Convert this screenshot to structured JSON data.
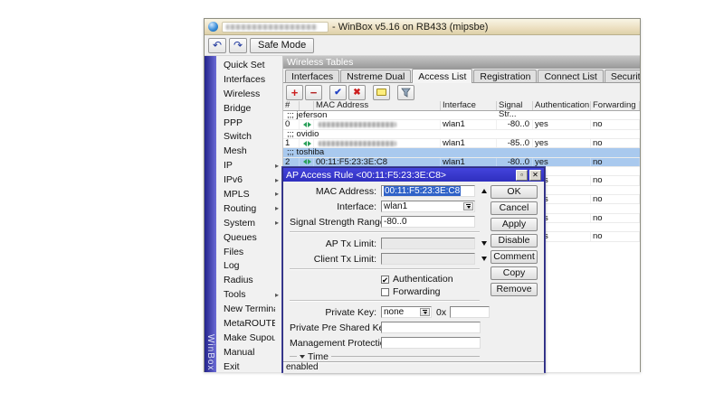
{
  "window": {
    "title_suffix": "- WinBox v5.16 on RB433 (mipsbe)",
    "brand": "WinBox",
    "toolbar": {
      "undo": "↶",
      "redo": "↷",
      "safe_mode": "Safe Mode"
    }
  },
  "sidebar": {
    "items": [
      {
        "label": "Quick Set",
        "submenu": false
      },
      {
        "label": "Interfaces",
        "submenu": false
      },
      {
        "label": "Wireless",
        "submenu": false
      },
      {
        "label": "Bridge",
        "submenu": false
      },
      {
        "label": "PPP",
        "submenu": false
      },
      {
        "label": "Switch",
        "submenu": false
      },
      {
        "label": "Mesh",
        "submenu": false
      },
      {
        "label": "IP",
        "submenu": true
      },
      {
        "label": "IPv6",
        "submenu": true
      },
      {
        "label": "MPLS",
        "submenu": true
      },
      {
        "label": "Routing",
        "submenu": true
      },
      {
        "label": "System",
        "submenu": true
      },
      {
        "label": "Queues",
        "submenu": false
      },
      {
        "label": "Files",
        "submenu": false
      },
      {
        "label": "Log",
        "submenu": false
      },
      {
        "label": "Radius",
        "submenu": false
      },
      {
        "label": "Tools",
        "submenu": true
      },
      {
        "label": "New Terminal",
        "submenu": false
      },
      {
        "label": "MetaROUTER",
        "submenu": false
      },
      {
        "label": "Make Supout.rif",
        "submenu": false
      },
      {
        "label": "Manual",
        "submenu": false
      },
      {
        "label": "Exit",
        "submenu": false
      }
    ]
  },
  "panel": {
    "title": "Wireless Tables",
    "tabs": [
      {
        "label": "Interfaces",
        "active": false
      },
      {
        "label": "Nstreme Dual",
        "active": false
      },
      {
        "label": "Access List",
        "active": true
      },
      {
        "label": "Registration",
        "active": false
      },
      {
        "label": "Connect List",
        "active": false
      },
      {
        "label": "Security Profiles",
        "active": false
      }
    ],
    "toolbar_icons": [
      "add-icon",
      "remove-icon",
      "enable-icon",
      "disable-icon",
      "comment-icon",
      "filter-icon"
    ],
    "table": {
      "columns": [
        "#",
        "",
        "MAC Address",
        "Interface",
        "Signal Str...",
        "Authentication",
        "Forwarding"
      ],
      "rows": [
        {
          "comment": true,
          "comment_text": ";;; jeferson",
          "selected": false,
          "redacted": false
        },
        {
          "comment": false,
          "num": "0",
          "mac": "",
          "redacted": true,
          "iface": "wlan1",
          "signal": "-80..0",
          "auth": "yes",
          "fwd": "no",
          "selected": false
        },
        {
          "comment": true,
          "comment_text": ";;; ovidio",
          "selected": false,
          "redacted": false
        },
        {
          "comment": false,
          "num": "1",
          "mac": "",
          "redacted": true,
          "iface": "wlan1",
          "signal": "-85..0",
          "auth": "yes",
          "fwd": "no",
          "selected": false
        },
        {
          "comment": true,
          "comment_text": ";;; toshiba",
          "selected": true,
          "redacted": false
        },
        {
          "comment": false,
          "num": "2",
          "mac": "00:11:F5:23:3E:C8",
          "redacted": false,
          "iface": "wlan1",
          "signal": "-80..0",
          "auth": "yes",
          "fwd": "no",
          "selected": true
        },
        {
          "comment": true,
          "comment_text": "",
          "selected": false,
          "redacted": false
        },
        {
          "comment": false,
          "num": "",
          "mac": "",
          "redacted": false,
          "iface": "",
          "signal": "",
          "auth": "yes",
          "fwd": "no",
          "selected": false
        },
        {
          "comment": true,
          "comment_text": "",
          "selected": false,
          "redacted": false
        },
        {
          "comment": false,
          "num": "",
          "mac": "",
          "redacted": false,
          "iface": "",
          "signal": "",
          "auth": "yes",
          "fwd": "no",
          "selected": false
        },
        {
          "comment": true,
          "comment_text": "",
          "selected": false,
          "redacted": false
        },
        {
          "comment": false,
          "num": "",
          "mac": "",
          "redacted": false,
          "iface": "",
          "signal": "",
          "auth": "yes",
          "fwd": "no",
          "selected": false
        },
        {
          "comment": true,
          "comment_text": "",
          "selected": false,
          "redacted": false
        },
        {
          "comment": false,
          "num": "",
          "mac": "",
          "redacted": false,
          "iface": "",
          "signal": "",
          "auth": "yes",
          "fwd": "no",
          "selected": false
        }
      ]
    }
  },
  "dialog": {
    "title": "AP Access Rule <00:11:F5:23:3E:C8>",
    "fields": {
      "mac_label": "MAC Address:",
      "mac_value": "00:11:F5:23:3E:C8",
      "interface_label": "Interface:",
      "interface_value": "wlan1",
      "signal_label": "Signal Strength Range:",
      "signal_value": "-80..0",
      "ap_tx_label": "AP Tx Limit:",
      "client_tx_label": "Client Tx Limit:",
      "auth_label": "Authentication",
      "auth_check": "✔",
      "fwd_label": "Forwarding",
      "private_key_label": "Private Key:",
      "private_key_value": "none",
      "hex_prefix": "0x",
      "ppsk_label": "Private Pre Shared Key:",
      "mpk_label": "Management Protection Key:",
      "time_section": "Time"
    },
    "buttons": [
      "OK",
      "Cancel",
      "Apply",
      "Disable",
      "Comment",
      "Copy",
      "Remove"
    ],
    "status": "enabled"
  },
  "colors": {
    "dialog_title_blue": "#3434d0",
    "selection_blue": "#a9c9ee",
    "text_selection": "#2f62c8",
    "brand_band_blue": "#23238b",
    "titlebar_beige": "#ecdfc0"
  }
}
